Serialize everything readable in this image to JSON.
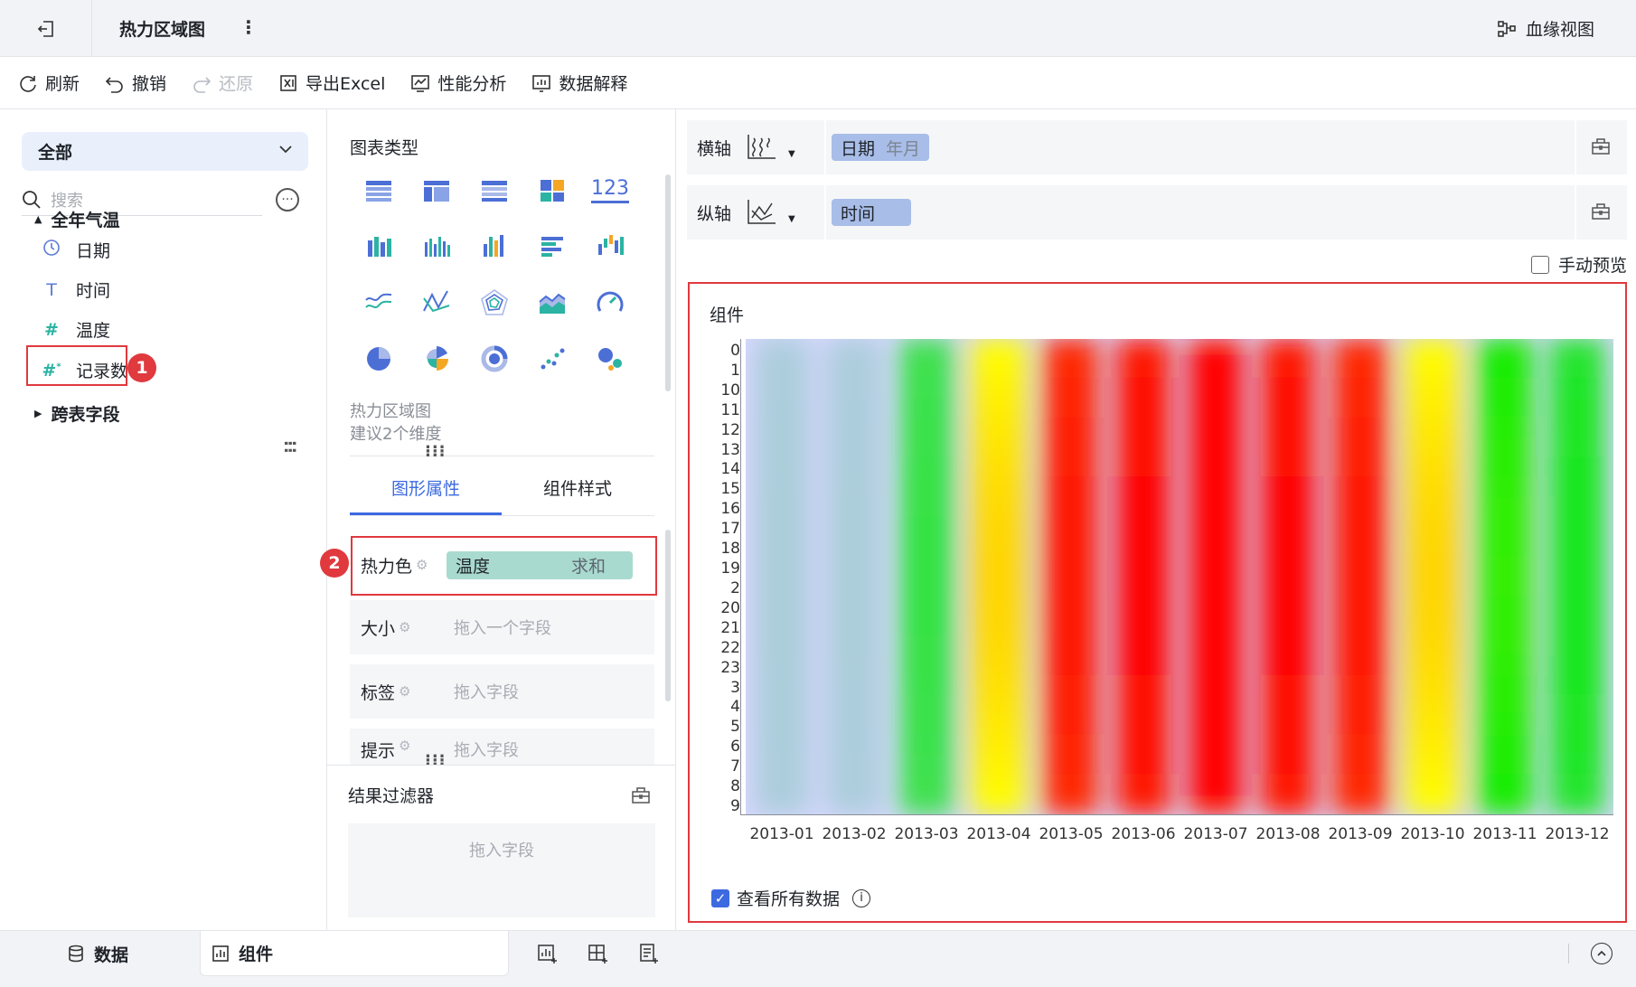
{
  "header": {
    "title": "热力区域图",
    "lineage_label": "血缘视图"
  },
  "toolbar": {
    "refresh": "刷新",
    "undo": "撤销",
    "redo": "还原",
    "export_excel": "导出Excel",
    "perf": "性能分析",
    "explain": "数据解释"
  },
  "left": {
    "scope": "全部",
    "search_placeholder": "搜索",
    "group1": "全年气温",
    "fields": [
      {
        "name": "日期",
        "icon": "clock-icon"
      },
      {
        "name": "时间",
        "icon": "text-type-icon"
      },
      {
        "name": "温度",
        "icon": "number-type-icon"
      },
      {
        "name": "记录数",
        "icon": "calc-number-icon"
      }
    ],
    "group2": "跨表字段",
    "badge1": "1"
  },
  "mid": {
    "chart_type_title": "图表类型",
    "chart_desc_name": "热力区域图",
    "chart_desc_hint": "建议2个维度",
    "tab_graph": "图形属性",
    "tab_style": "组件样式",
    "badge2": "2",
    "props": [
      {
        "label": "热力色",
        "field": "温度",
        "agg": "求和"
      },
      {
        "label": "大小",
        "placeholder": "拖入一个字段"
      },
      {
        "label": "标签",
        "placeholder": "拖入字段"
      },
      {
        "label": "提示",
        "placeholder": "拖入字段"
      }
    ],
    "filter_title": "结果过滤器",
    "filter_placeholder": "拖入字段",
    "num_icon_text": "123"
  },
  "right": {
    "x_axis_label": "横轴",
    "x_field": "日期",
    "x_field_sub": "年月",
    "y_axis_label": "纵轴",
    "y_field": "时间",
    "manual_preview": "手动预览",
    "component_title": "组件",
    "see_all": "查看所有数据"
  },
  "chart_data": {
    "type": "heatmap",
    "title": "",
    "categories_x": [
      "2013-01",
      "2013-02",
      "2013-03",
      "2013-04",
      "2013-05",
      "2013-06",
      "2013-07",
      "2013-08",
      "2013-09",
      "2013-10",
      "2013-11",
      "2013-12"
    ],
    "categories_y": [
      "0",
      "1",
      "10",
      "11",
      "12",
      "13",
      "14",
      "15",
      "16",
      "17",
      "18",
      "19",
      "2",
      "20",
      "21",
      "22",
      "23",
      "3",
      "4",
      "5",
      "6",
      "7",
      "8",
      "9"
    ],
    "intensity": [
      0.05,
      0.05,
      0.25,
      0.62,
      0.88,
      0.95,
      1.0,
      0.95,
      0.88,
      0.62,
      0.38,
      0.3
    ],
    "colors": [
      "#c8c8ff",
      "#00ff00",
      "#ffff00",
      "#ff0000"
    ]
  },
  "bottom": {
    "data_tab": "数据",
    "component_tab": "组件"
  },
  "colors": {
    "accent": "#3d6ae0",
    "highlight": "#e0393e"
  }
}
